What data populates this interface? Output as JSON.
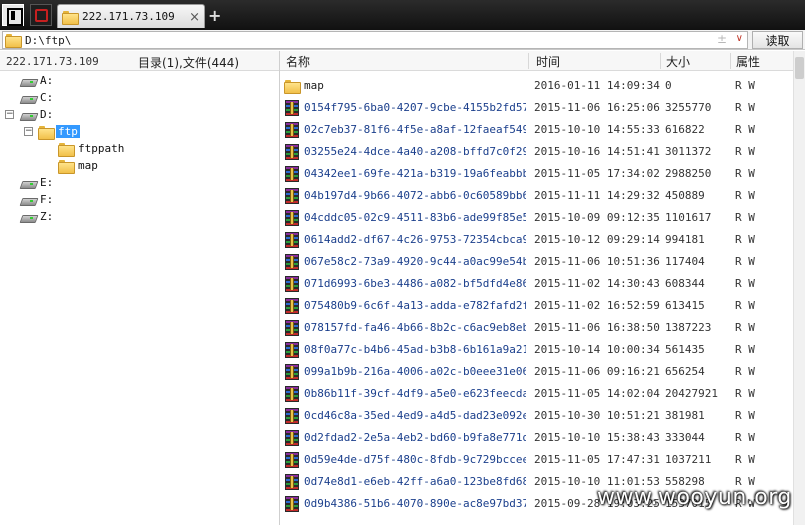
{
  "tab": {
    "label": "222.171.73.109"
  },
  "toolbar": {
    "add_tab": "+",
    "close_tab": "×"
  },
  "address": {
    "path": "D:\\ftp\\",
    "read_button": "读取",
    "swap_symbol": "±",
    "dropdown_symbol": "∨"
  },
  "left_panel": {
    "host": "222.171.73.109",
    "summary": "目录(1),文件(444)",
    "tree": [
      {
        "label": "A:",
        "type": "drive"
      },
      {
        "label": "C:",
        "type": "drive"
      },
      {
        "label": "D:",
        "type": "drive",
        "expander": "−"
      },
      {
        "label": "ftp",
        "type": "folder",
        "expander": "−",
        "selected": true
      },
      {
        "label": "ftppath",
        "type": "folder"
      },
      {
        "label": "map",
        "type": "folder"
      },
      {
        "label": "E:",
        "type": "drive"
      },
      {
        "label": "F:",
        "type": "drive"
      },
      {
        "label": "Z:",
        "type": "drive"
      }
    ]
  },
  "columns": {
    "name": "名称",
    "time": "时间",
    "size": "大小",
    "attr": "属性"
  },
  "files": [
    {
      "name": "map",
      "time": "2016-01-11 14:09:34",
      "size": "0",
      "attr": "R W",
      "type": "folder"
    },
    {
      "name": "0154f795-6ba0-4207-9cbe-4155b2fd579...",
      "time": "2015-11-06 16:25:06",
      "size": "3255770",
      "attr": "R W",
      "type": "archive"
    },
    {
      "name": "02c7eb37-81f6-4f5e-a8af-12faeaf549a...",
      "time": "2015-10-10 14:55:33",
      "size": "616822",
      "attr": "R W",
      "type": "archive"
    },
    {
      "name": "03255e24-4dce-4a40-a208-bffd7c0f295...",
      "time": "2015-10-16 14:51:41",
      "size": "3011372",
      "attr": "R W",
      "type": "archive"
    },
    {
      "name": "04342ee1-69fe-421a-b319-19a6feabbb6...",
      "time": "2015-11-05 17:34:02",
      "size": "2988250",
      "attr": "R W",
      "type": "archive"
    },
    {
      "name": "04b197d4-9b66-4072-abb6-0c60589bb69...",
      "time": "2015-11-11 14:29:32",
      "size": "450889",
      "attr": "R W",
      "type": "archive"
    },
    {
      "name": "04cddc05-02c9-4511-83b6-ade99f85e54...",
      "time": "2015-10-09 09:12:35",
      "size": "1101617",
      "attr": "R W",
      "type": "archive"
    },
    {
      "name": "0614add2-df67-4c26-9753-72354cbca94...",
      "time": "2015-10-12 09:29:14",
      "size": "994181",
      "attr": "R W",
      "type": "archive"
    },
    {
      "name": "067e58c2-73a9-4920-9c44-a0ac99e54be...",
      "time": "2015-11-06 10:51:36",
      "size": "117404",
      "attr": "R W",
      "type": "archive"
    },
    {
      "name": "071d6993-6be3-4486-a082-bf5dfd4e86f...",
      "time": "2015-11-02 14:30:43",
      "size": "608344",
      "attr": "R W",
      "type": "archive"
    },
    {
      "name": "075480b9-6c6f-4a13-adda-e782fafd2f3...",
      "time": "2015-11-02 16:52:59",
      "size": "613415",
      "attr": "R W",
      "type": "archive"
    },
    {
      "name": "078157fd-fa46-4b66-8b2c-c6ac9eb8ebb...",
      "time": "2015-11-06 16:38:50",
      "size": "1387223",
      "attr": "R W",
      "type": "archive"
    },
    {
      "name": "08f0a77c-b4b6-45ad-b3b8-6b161a9a213...",
      "time": "2015-10-14 10:00:34",
      "size": "561435",
      "attr": "R W",
      "type": "archive"
    },
    {
      "name": "099a1b9b-216a-4006-a02c-b0eee31e06c...",
      "time": "2015-11-06 09:16:21",
      "size": "656254",
      "attr": "R W",
      "type": "archive"
    },
    {
      "name": "0b86b11f-39cf-4df9-a5e0-e623feecda8...",
      "time": "2015-11-05 14:02:04",
      "size": "20427921",
      "attr": "R W",
      "type": "archive"
    },
    {
      "name": "0cd46c8a-35ed-4ed9-a4d5-dad23e092e0...",
      "time": "2015-10-30 10:51:21",
      "size": "381981",
      "attr": "R W",
      "type": "archive"
    },
    {
      "name": "0d2fdad2-2e5a-4eb2-bd60-b9fa8e771d0...",
      "time": "2015-10-10 15:38:43",
      "size": "333044",
      "attr": "R W",
      "type": "archive"
    },
    {
      "name": "0d59e4de-d75f-480c-8fdb-9c729bccee4...",
      "time": "2015-11-05 17:47:31",
      "size": "1037211",
      "attr": "R W",
      "type": "archive"
    },
    {
      "name": "0d74e8d1-e6eb-42ff-a6a0-123be8fd68a...",
      "time": "2015-10-10 11:01:53",
      "size": "558298",
      "attr": "R W",
      "type": "archive"
    },
    {
      "name": "0d9b4386-51b6-4070-890e-ac8e97bd370...",
      "time": "2015-09-28 19:03:25",
      "size": "1537015",
      "attr": "R W",
      "type": "archive"
    }
  ],
  "watermark": "www.wooyun.org"
}
